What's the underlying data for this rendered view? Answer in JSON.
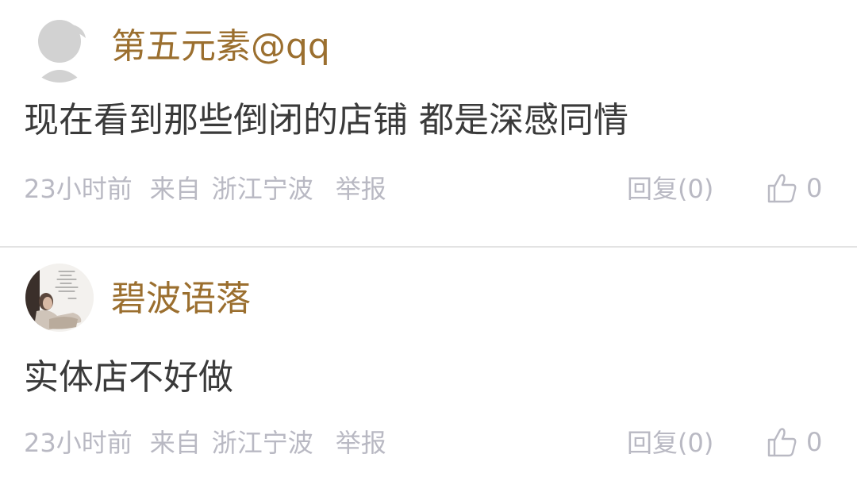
{
  "comments": [
    {
      "username": "第五元素@qq",
      "avatar_icon": "default-user-avatar",
      "content": "现在看到那些倒闭的店铺 都是深感同情",
      "time": "23小时前",
      "source_prefix": "来自",
      "location": "浙江宁波",
      "report_label": "举报",
      "reply_label": "回复(0)",
      "like_icon": "thumbs-up-icon",
      "like_count": "0"
    },
    {
      "username": "碧波语落",
      "avatar_icon": "photo-avatar",
      "content": "实体店不好做",
      "time": "23小时前",
      "source_prefix": "来自",
      "location": "浙江宁波",
      "report_label": "举报",
      "reply_label": "回复(0)",
      "like_icon": "thumbs-up-icon",
      "like_count": "0"
    }
  ],
  "colors": {
    "username": "#9b6f2f",
    "content": "#3a3a3a",
    "meta": "#b9b9c3",
    "divider": "#e3e3e3"
  }
}
